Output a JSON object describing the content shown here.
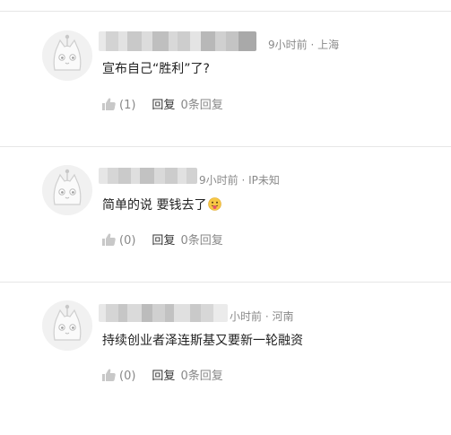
{
  "comments": [
    {
      "meta": "9小时前 · 上海",
      "text": "宣布自己“胜利”了?",
      "like_count": "(1)",
      "reply_label": "回复",
      "reply_count": "0条回复",
      "avatar_icon": "cat-avatar-icon",
      "like_icon": "thumbs-up-icon"
    },
    {
      "meta": "9小时前 · IP未知",
      "text": "简单的说 要钱去了",
      "emoji": "tongue-out-face-emoji",
      "like_count": "(0)",
      "reply_label": "回复",
      "reply_count": "0条回复",
      "avatar_icon": "cat-avatar-icon",
      "like_icon": "thumbs-up-icon"
    },
    {
      "meta": "小时前 · 河南",
      "text": "持续创业者泽连斯基又要新一轮融资",
      "like_count": "(0)",
      "reply_label": "回复",
      "reply_count": "0条回复",
      "avatar_icon": "cat-avatar-icon",
      "like_icon": "thumbs-up-icon"
    }
  ],
  "colors": {
    "meta_text": "#8a8a8a",
    "reply_label": "#333333",
    "divider": "#e6e6e6",
    "avatar_bg": "#f1f1f1"
  }
}
